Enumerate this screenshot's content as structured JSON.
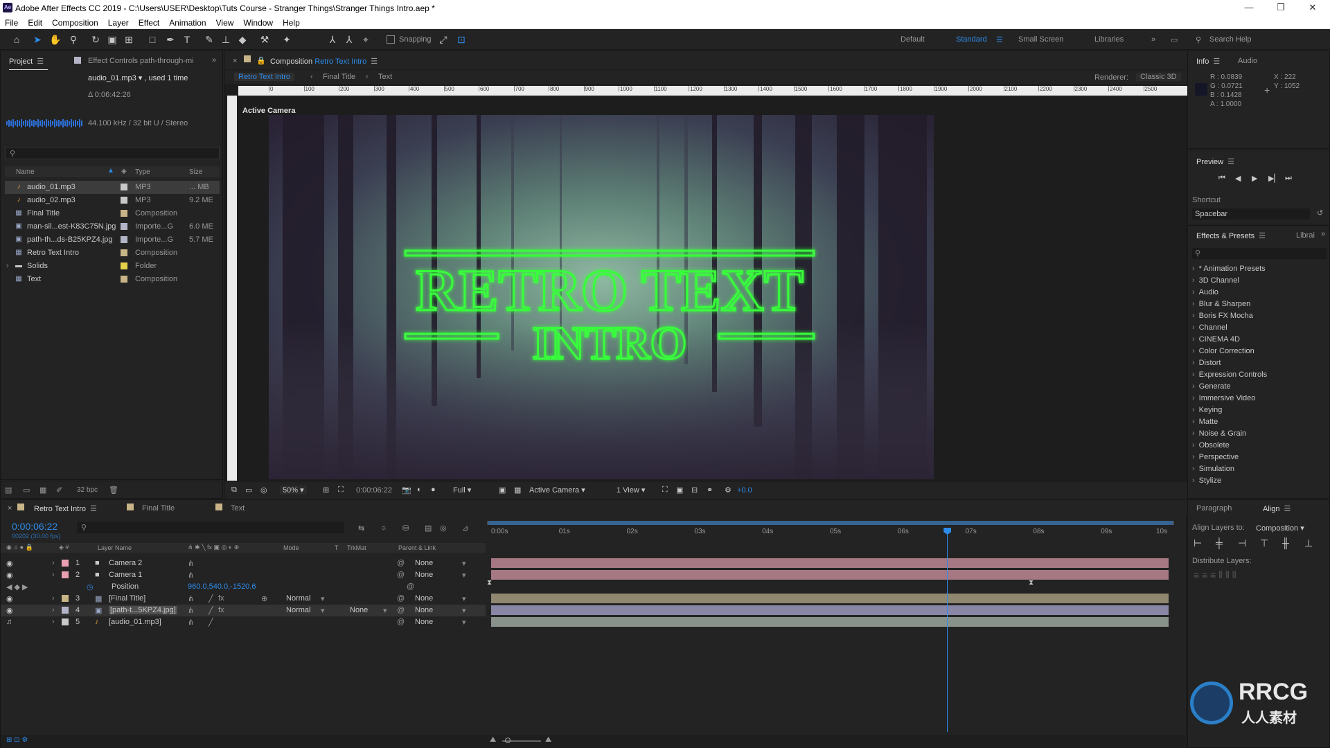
{
  "app": {
    "title": "Adobe After Effects CC 2019 - C:\\Users\\USER\\Desktop\\Tuts Course - Stranger Things\\Stranger Things Intro.aep *",
    "logo": "Ae"
  },
  "menu": [
    "File",
    "Edit",
    "Composition",
    "Layer",
    "Effect",
    "Animation",
    "View",
    "Window",
    "Help"
  ],
  "toolbar": {
    "snapping": "Snapping",
    "workspaces": [
      "Default",
      "Standard",
      "Small Screen",
      "Libraries"
    ],
    "search_placeholder": "Search Help"
  },
  "project": {
    "tab": "Project",
    "effect_controls_tab": "Effect Controls path-through-mi",
    "selected_name": "audio_01.mp3",
    "used": ", used 1 time",
    "duration": "Δ 0:06:42:26",
    "audio_info": "44.100 kHz / 32 bit U / Stereo",
    "columns": {
      "name": "Name",
      "type": "Type",
      "size": "Size"
    },
    "items": [
      {
        "name": "audio_01.mp3",
        "type": "MP3",
        "size": "... MB",
        "icon": "audio-icon",
        "label_color": "#c8c8c8"
      },
      {
        "name": "audio_02.mp3",
        "type": "MP3",
        "size": "9.2 ME",
        "icon": "audio-icon",
        "label_color": "#c8c8c8"
      },
      {
        "name": "Final Title",
        "type": "Composition",
        "size": "",
        "icon": "composition-icon",
        "label_color": "#c8b486"
      },
      {
        "name": "man-sil...est-K83C75N.jpg",
        "type": "Importe...G",
        "size": "6.0 ME",
        "icon": "image-icon",
        "label_color": "#b4b4c8"
      },
      {
        "name": "path-th...ds-B25KPZ4.jpg",
        "type": "Importe...G",
        "size": "5.7 ME",
        "icon": "image-icon",
        "label_color": "#b4b4c8"
      },
      {
        "name": "Retro Text Intro",
        "type": "Composition",
        "size": "",
        "icon": "composition-icon",
        "label_color": "#c8b486"
      },
      {
        "name": "Solids",
        "type": "Folder",
        "size": "",
        "icon": "folder-icon",
        "label_color": "#e6d24a"
      },
      {
        "name": "Text",
        "type": "Composition",
        "size": "",
        "icon": "composition-icon",
        "label_color": "#c8b486"
      }
    ],
    "bpc": "32 bpc"
  },
  "composition": {
    "tab_prefix": "Composition",
    "tab_name": "Retro Text Intro",
    "nav": [
      "Retro Text Intro",
      "Final Title",
      "Text"
    ],
    "renderer_label": "Renderer:",
    "renderer_value": "Classic 3D",
    "ruler_labels": [
      "0",
      "100",
      "200",
      "300",
      "400",
      "500",
      "600",
      "700",
      "800",
      "900",
      "1000",
      "1100",
      "1200",
      "1300",
      "1400",
      "1500",
      "1600",
      "1700",
      "1800",
      "1900",
      "2000",
      "2100",
      "2200",
      "2300",
      "2400",
      "2500"
    ],
    "active_camera_label": "Active Camera",
    "title_line1": "RETRO TEXT",
    "title_line2": "INTRO",
    "neon_color": "#39ff3a",
    "footer": {
      "zoom": "50%",
      "timecode": "0:00:06:22",
      "resolution": "Full",
      "camera": "Active Camera",
      "views": "1 View",
      "exposure": "+0.0"
    }
  },
  "info": {
    "tab": "Info",
    "audio_tab": "Audio",
    "r": "R : 0.0839",
    "g": "G : 0.0721",
    "b": "B : 0.1428",
    "a": "A : 1.0000",
    "x": "X : 222",
    "y": "Y : 1052"
  },
  "preview": {
    "tab": "Preview",
    "shortcut_label": "Shortcut",
    "shortcut_value": "Spacebar"
  },
  "effects": {
    "tab": "Effects & Presets",
    "libraries_tab": "Librai",
    "items": [
      "* Animation Presets",
      "3D Channel",
      "Audio",
      "Blur & Sharpen",
      "Boris FX Mocha",
      "Channel",
      "CINEMA 4D",
      "Color Correction",
      "Distort",
      "Expression Controls",
      "Generate",
      "Immersive Video",
      "Keying",
      "Matte",
      "Noise & Grain",
      "Obsolete",
      "Perspective",
      "Simulation",
      "Stylize"
    ]
  },
  "align": {
    "paragraph_tab": "Paragraph",
    "align_tab": "Align",
    "align_layers_to": "Align Layers to:",
    "align_target": "Composition",
    "distribute": "Distribute Layers:"
  },
  "timeline": {
    "tabs": [
      "Retro Text Intro",
      "Final Title",
      "Text"
    ],
    "timecode": "0:00:06:22",
    "frames": "00202 (30.00 fps)",
    "columns": {
      "layer_name": "Layer Name",
      "mode": "Mode",
      "t": "T",
      "trkmat": "TrkMat",
      "parent": "Parent & Link"
    },
    "time_labels": [
      "0:00s",
      "01s",
      "02s",
      "03s",
      "04s",
      "05s",
      "06s",
      "07s",
      "08s",
      "09s",
      "10s"
    ],
    "playhead_seconds": 6.73,
    "duration_seconds": 10,
    "layers": [
      {
        "num": "1",
        "name": "Camera 2",
        "mode": "",
        "trkmat": "",
        "parent": "None",
        "label_color": "#e8a0b0",
        "bar_color": "#a57884",
        "icon": "camera-icon"
      },
      {
        "num": "2",
        "name": "Camera 1",
        "mode": "",
        "trkmat": "",
        "parent": "None",
        "label_color": "#e8a0b0",
        "bar_color": "#a57884",
        "icon": "camera-icon"
      },
      {
        "num": "3",
        "name": "[Final Title]",
        "mode": "Normal",
        "trkmat": "",
        "parent": "None",
        "label_color": "#c8b486",
        "bar_color": "#8f8770",
        "icon": "composition-icon"
      },
      {
        "num": "4",
        "name": "[path-t...5KPZ4.jpg]",
        "mode": "Normal",
        "trkmat": "None",
        "parent": "None",
        "label_color": "#b4b4c8",
        "bar_color": "#8a86a6",
        "icon": "image-icon"
      },
      {
        "num": "5",
        "name": "[audio_01.mp3]",
        "mode": "",
        "trkmat": "",
        "parent": "None",
        "label_color": "#c8c8c8",
        "bar_color": "#89928a",
        "icon": "audio-icon"
      }
    ],
    "position_property": {
      "name": "Position",
      "value": "960.0,540.0,-1520.6"
    }
  },
  "watermark": {
    "text": "RRCG",
    "subtext": "人人素材"
  }
}
